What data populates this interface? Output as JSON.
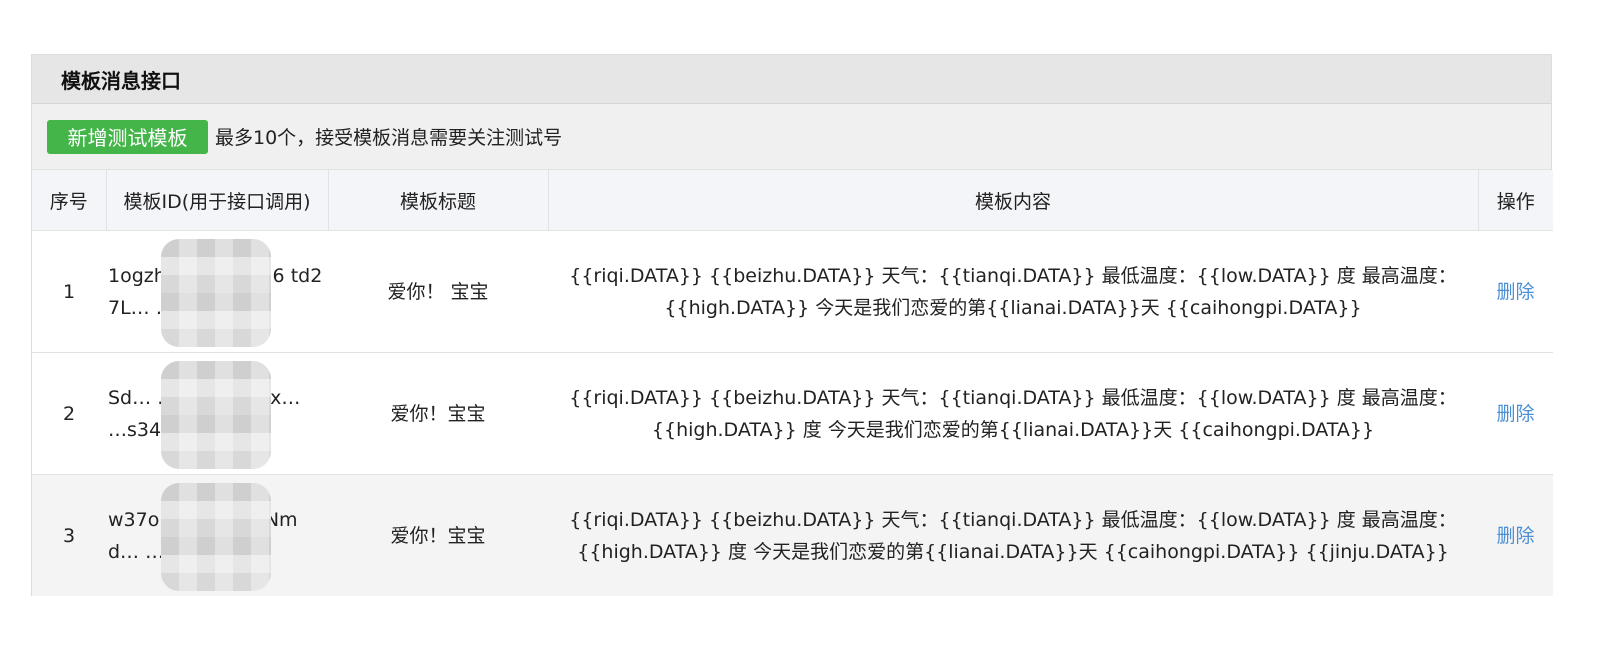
{
  "panel": {
    "title": "模板消息接口"
  },
  "toolbar": {
    "add_label": "新增测试模板",
    "note": "最多10个，接受模板消息需要关注测试号"
  },
  "table": {
    "headers": [
      "序号",
      "模板ID(用于接口调用)",
      "模板标题",
      "模板内容",
      "操作"
    ],
    "rows": [
      {
        "index": "1",
        "template_id": "1ogzh… …nDrSLI6 td27L… …nTGNr",
        "title": "爱你！ 宝宝",
        "content": "{{riqi.DATA}} {{beizhu.DATA}} 天气：{{tianqi.DATA}} 最低温度：{{low.DATA}} 度 最高温度：{{high.DATA}} 今天是我们恋爱的第{{lianai.DATA}}天 {{caihongpi.DATA}}",
        "action": "删除"
      },
      {
        "index": "2",
        "template_id": "Sd… …l61A6 tQox… …s34al",
        "title": "爱你！宝宝",
        "content": "{{riqi.DATA}} {{beizhu.DATA}} 天气：{{tianqi.DATA}} 最低温度：{{low.DATA}} 度 最高温度：{{high.DATA}} 度 今天是我们恋爱的第{{lianai.DATA}}天 {{caihongpi.DATA}}",
        "action": "删除"
      },
      {
        "index": "3",
        "template_id": "w37o… …WyG kNmd… …Zqg",
        "title": "爱你！宝宝",
        "content": "{{riqi.DATA}} {{beizhu.DATA}} 天气：{{tianqi.DATA}} 最低温度：{{low.DATA}} 度 最高温度：{{high.DATA}} 度 今天是我们恋爱的第{{lianai.DATA}}天 {{caihongpi.DATA}} {{jinju.DATA}}",
        "action": "删除"
      }
    ]
  },
  "colors": {
    "add_button": "#44b549",
    "link": "#4a8fd6"
  }
}
